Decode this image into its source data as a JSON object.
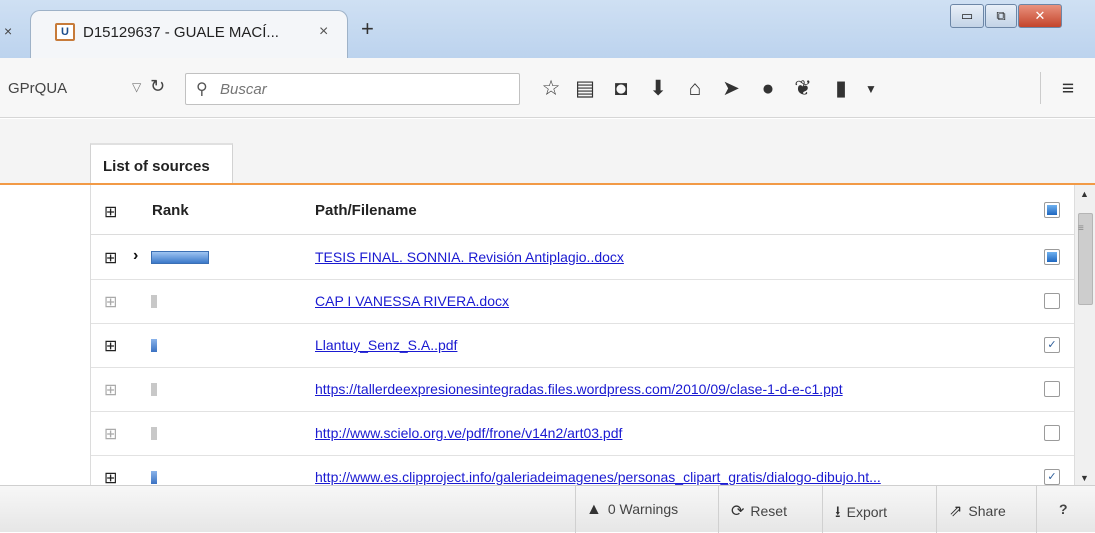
{
  "browser": {
    "prev_tab_close": "×",
    "tab": {
      "title": "D15129637 - GUALE MACÍ...",
      "close": "×",
      "favicon": "U"
    },
    "new_tab": "+",
    "window_buttons": {
      "minimize": "▭",
      "maximize": "⧉",
      "close": "✕"
    },
    "url_text": "GPrQUA",
    "url_dropdown": "▽",
    "reload": "↻",
    "search": {
      "placeholder": "Buscar"
    },
    "toolbar_icons": [
      "star-icon",
      "reading-list-icon",
      "pocket-icon",
      "download-icon",
      "home-icon",
      "send-icon",
      "chat-icon",
      "extension-icon",
      "device-icon",
      "dropdown-icon",
      "menu-icon"
    ]
  },
  "panel": {
    "tab_label": "List of sources",
    "columns": {
      "expand": "⊞",
      "rank": "Rank",
      "path": "Path/Filename"
    },
    "rows": [
      {
        "expand": "⊞",
        "rank_level": 1.0,
        "path": "TESIS FINAL. SONNIA. Revisión Antiplagio..docx",
        "selected": true,
        "check": "full"
      },
      {
        "expand": "⊞",
        "rank_level": 0.1,
        "path": "CAP I VANESSA RIVERA.docx",
        "selected": false,
        "check": "none"
      },
      {
        "expand": "⊞",
        "rank_level": 0.1,
        "path": "Llantuy_Senz_S.A..pdf",
        "selected": false,
        "check": "checked"
      },
      {
        "expand": "⊞",
        "rank_level": 0.1,
        "path": "https://tallerdeexpresionesintegradas.files.wordpress.com/2010/09/clase-1-d-e-c1.ppt",
        "selected": false,
        "check": "none"
      },
      {
        "expand": "⊞",
        "rank_level": 0.1,
        "path": "http://www.scielo.org.ve/pdf/frone/v14n2/art03.pdf",
        "selected": false,
        "check": "none"
      },
      {
        "expand": "⊞",
        "rank_level": 0.1,
        "path": "http://www.es.clipproject.info/galeriadeimagenes/personas_clipart_gratis/dialogo-dibujo.ht...",
        "selected": false,
        "check": "checked"
      }
    ]
  },
  "footer": {
    "warnings": "0 Warnings",
    "reset": "Reset",
    "export": "Export",
    "share": "Share",
    "help": "?"
  },
  "colors": {
    "accent": "#f29a46",
    "link": "#1a1ad1",
    "rank_bar": "#3c79c9"
  }
}
